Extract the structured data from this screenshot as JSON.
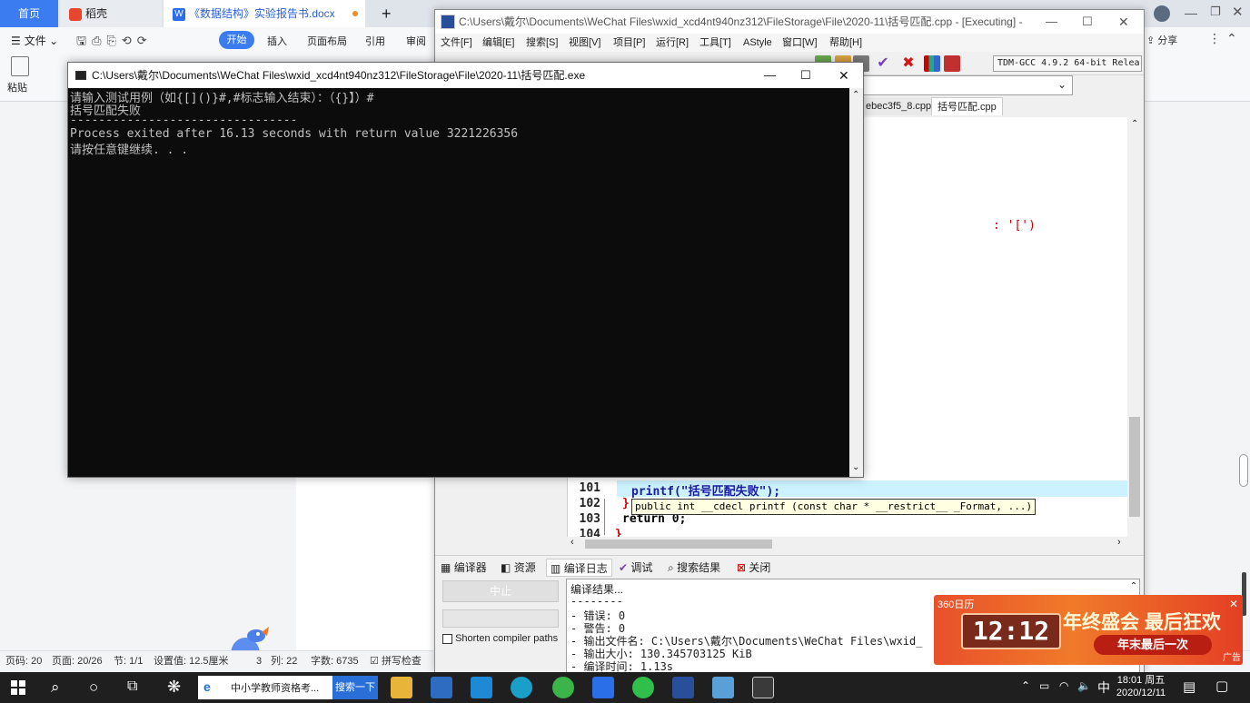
{
  "wps": {
    "tabs": [
      "首页",
      "稻壳",
      "《数据结构》实验报告书.docx"
    ],
    "new_tab": "+",
    "menu": [
      "文件",
      "开始",
      "插入",
      "页面布局",
      "引用",
      "审阅"
    ],
    "share": "分享",
    "paste": "粘贴",
    "status": {
      "page_code": "页码: 20",
      "page": "页面: 20/26",
      "section": "节: 1/1",
      "setting": "设置值: 12.5厘米",
      "row": "3",
      "col": "列: 22",
      "words": "字数: 6735",
      "spell": "拼写检查"
    }
  },
  "devcpp": {
    "title": "C:\\Users\\戴尔\\Documents\\WeChat Files\\wxid_xcd4nt940nz312\\FileStorage\\File\\2020-11\\括号匹配.cpp - [Executing] - De...",
    "menu": [
      "文件[F]",
      "编辑[E]",
      "搜索[S]",
      "视图[V]",
      "项目[P]",
      "运行[R]",
      "工具[T]",
      "AStyle",
      "窗口[W]",
      "帮助[H]"
    ],
    "compiler": "TDM-GCC 4.9.2 64-bit Relea",
    "file_tabs": [
      "ebec3f5_8.cpp",
      "括号匹配.cpp"
    ],
    "code_fragment": ": '[')",
    "lines": [
      {
        "num": "101",
        "code": "printf(\"括号匹配失败\");"
      },
      {
        "num": "102",
        "code": "}"
      },
      {
        "num": "103",
        "code": "return 0;"
      },
      {
        "num": "104",
        "code": "}"
      }
    ],
    "tooltip": "public int __cdecl printf (const char * __restrict__ _Format, ...)",
    "bottom_tabs": [
      "编译器",
      "资源",
      "编译日志",
      "调试",
      "搜索结果",
      "关闭"
    ],
    "abort_button": "中止",
    "shorten_paths": "Shorten compiler paths",
    "log": [
      "编译结果...",
      "--------",
      "- 错误: 0",
      "- 警告: 0",
      "- 输出文件名: C:\\Users\\戴尔\\Documents\\WeChat Files\\wxid_",
      "- 输出大小: 130.345703125 KiB",
      "- 编译时间: 1.13s"
    ]
  },
  "console": {
    "title": "C:\\Users\\戴尔\\Documents\\WeChat Files\\wxid_xcd4nt940nz312\\FileStorage\\File\\2020-11\\括号匹配.exe",
    "lines": [
      "请输入测试用例（如{[]()}#,#标志输入结束）：（{}】）#",
      "括号匹配失败",
      "--------------------------------",
      "Process exited after 16.13 seconds with return value 3221226356",
      "请按任意键继续. . ."
    ]
  },
  "ad": {
    "brand": "360日历",
    "clock": "12:12",
    "headline": "年终盛会 最后狂欢",
    "sub": "年末最后一次",
    "tag": "广告"
  },
  "taskbar": {
    "search_text": "中小学教师资格考...",
    "search_button": "搜索一下",
    "ime": "中",
    "time": "18:01 周五",
    "date": "2020/12/11"
  }
}
